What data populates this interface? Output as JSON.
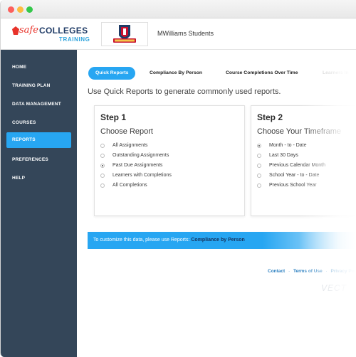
{
  "header": {
    "logo_safe": "safe",
    "logo_colleges": "COLLEGES",
    "logo_training": "TRAINING",
    "org_name": "MWilliams Students"
  },
  "sidebar": {
    "items": [
      {
        "label": "HOME",
        "active": false
      },
      {
        "label": "TRAINING PLAN",
        "active": false
      },
      {
        "label": "DATA MANAGEMENT",
        "active": false
      },
      {
        "label": "COURSES",
        "active": false
      },
      {
        "label": "REPORTS",
        "active": true
      },
      {
        "label": "PREFERENCES",
        "active": false
      },
      {
        "label": "HELP",
        "active": false
      }
    ]
  },
  "tabs": [
    {
      "label": "Quick Reports",
      "active": true
    },
    {
      "label": "Compliance By Person",
      "active": false
    },
    {
      "label": "Course Completions Over Time",
      "active": false
    },
    {
      "label": "Learners In",
      "active": false
    }
  ],
  "intro": "Use Quick Reports to generate commonly used reports.",
  "step1": {
    "title": "Step 1",
    "subtitle": "Choose Report",
    "options": [
      {
        "label": "All Assignments",
        "checked": false
      },
      {
        "label": "Outstanding Assignments",
        "checked": false
      },
      {
        "label": "Past Due Assignments",
        "checked": true
      },
      {
        "label": "Learners with Completions",
        "checked": false
      },
      {
        "label": "All Completions",
        "checked": false
      }
    ]
  },
  "step2": {
    "title": "Step 2",
    "subtitle": "Choose Your Timeframe",
    "options": [
      {
        "label": "Month - to - Date",
        "checked": true
      },
      {
        "label": "Last 30 Days",
        "checked": false
      },
      {
        "label": "Previous Calendar Month",
        "checked": false
      },
      {
        "label": "School Year - to - Date",
        "checked": false
      },
      {
        "label": "Previous School Year",
        "checked": false
      }
    ]
  },
  "info": {
    "text": "To customize this data, please use Reports: ",
    "link": "Compliance by Person"
  },
  "footer": {
    "contact": "Contact",
    "terms": "Terms of Use",
    "privacy": "Privacy Po",
    "sep": "·",
    "logo": "VECT"
  },
  "colors": {
    "accent": "#27a6f2",
    "sidebar": "#344659",
    "logo_red": "#e8332a",
    "logo_navy": "#1f3b66"
  }
}
